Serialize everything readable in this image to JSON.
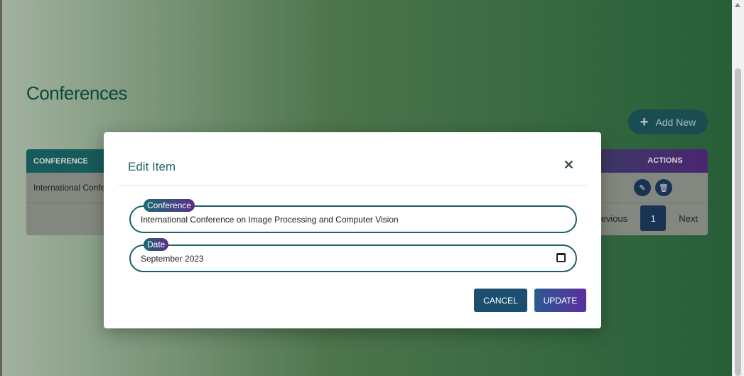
{
  "page": {
    "title": "Conferences",
    "add_button": {
      "icon": "plus-icon",
      "label": "Add New"
    }
  },
  "table": {
    "headers": [
      "CONFERENCE",
      "ACTIONS"
    ],
    "rows": [
      {
        "conference": "International Conference on Image Processing and Computer Vision",
        "actions": [
          "edit-icon",
          "delete-icon"
        ]
      }
    ],
    "pagination": {
      "previous": "Previous",
      "current": "1",
      "next": "Next"
    }
  },
  "modal": {
    "title": "Edit Item",
    "close_icon": "close-icon",
    "fields": [
      {
        "label": "Conference",
        "value": "International Conference on Image Processing and Computer Vision"
      },
      {
        "label": "Date",
        "value": "September 2023",
        "icon": "calendar-icon"
      }
    ],
    "buttons": {
      "cancel": "CANCEL",
      "update": "UPDATE"
    }
  },
  "colors": {
    "accent_teal": "#1d6a64",
    "accent_purple": "#5a2e8a",
    "button_dark": "#1c4f6e"
  }
}
